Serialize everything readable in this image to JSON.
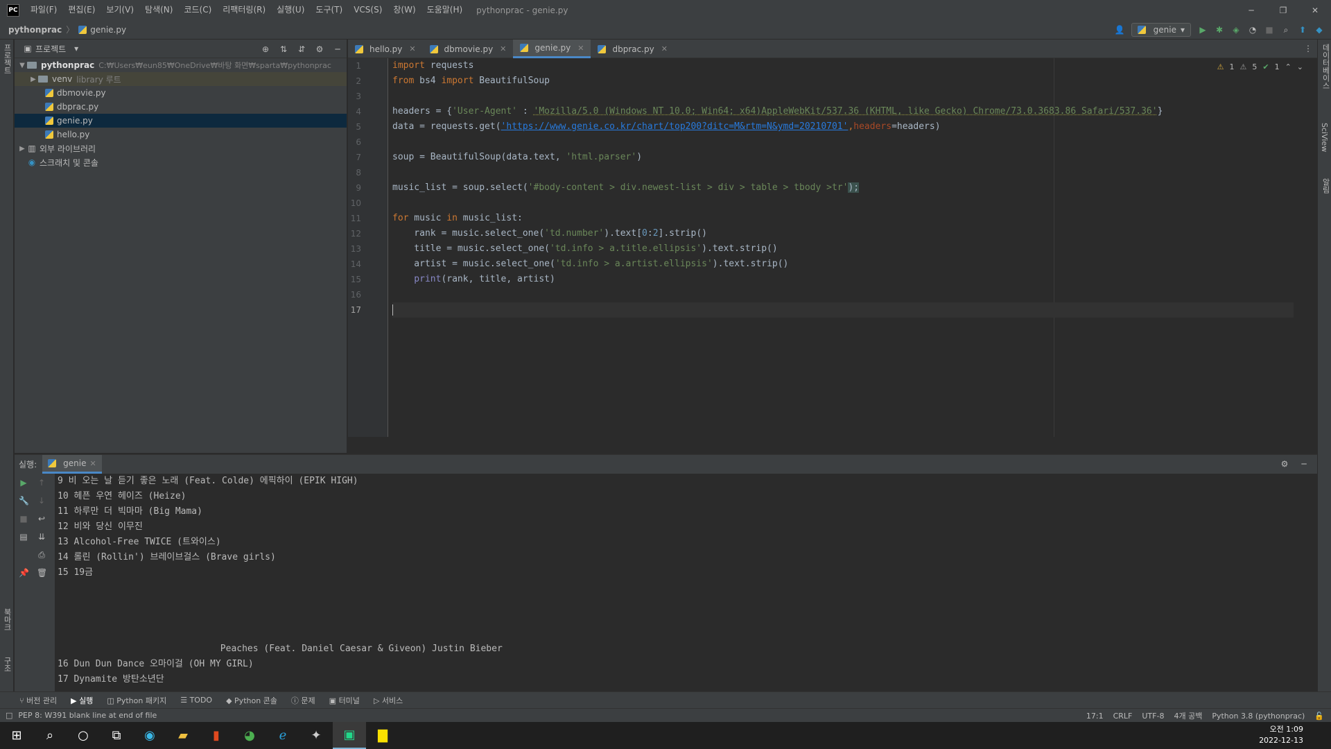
{
  "app": {
    "logo": "PC",
    "window_title": "pythonprac - genie.py"
  },
  "menu": [
    "파일(F)",
    "편집(E)",
    "보기(V)",
    "탐색(N)",
    "코드(C)",
    "리팩터링(R)",
    "실행(U)",
    "도구(T)",
    "VCS(S)",
    "창(W)",
    "도움말(H)"
  ],
  "breadcrumb": {
    "project": "pythonprac",
    "file": "genie.py"
  },
  "run_config": {
    "name": "genie"
  },
  "left_strip": {
    "project_tab": "프로젝트",
    "bookmarks_tab": "북마크",
    "structure_tab": "구조"
  },
  "right_strip": {
    "db_tab": "데이터베이스",
    "sciview_tab": "SciView",
    "notifications_tab": "알림"
  },
  "project_panel": {
    "title": "프로젝트",
    "root": {
      "name": "pythonprac",
      "path": "C:₩Users₩eun85₩OneDrive₩바탕 화면₩sparta₩pythonprac"
    },
    "venv": {
      "name": "venv",
      "note": "library 루트"
    },
    "files": [
      "dbmovie.py",
      "dbprac.py",
      "genie.py",
      "hello.py"
    ],
    "external": "외부 라이브러리",
    "scratches": "스크래치 및 콘솔"
  },
  "editor_tabs": [
    "hello.py",
    "dbmovie.py",
    "genie.py",
    "dbprac.py"
  ],
  "active_tab": "genie.py",
  "inspections": {
    "warnings": "1",
    "weak_warnings": "5",
    "ok": "1"
  },
  "line_numbers": [
    "1",
    "2",
    "3",
    "4",
    "5",
    "6",
    "7",
    "8",
    "9",
    "10",
    "11",
    "12",
    "13",
    "14",
    "15",
    "16",
    "17"
  ],
  "code": {
    "l1_kw": "import",
    "l1_rest": " requests",
    "l2_kw1": "from",
    "l2_mid": " bs4 ",
    "l2_kw2": "import",
    "l2_rest": " BeautifulSoup",
    "l4_a": "headers = {",
    "l4_key": "'User-Agent'",
    "l4_colon": " : ",
    "l4_val": "'Mozilla/5.0 (Windows NT 10.0; Win64; x64)AppleWebKit/537.36 (KHTML, like Gecko) Chrome/73.0.3683.86 Safari/537.36'",
    "l4_end": "}",
    "l5_a": "data = requests.get(",
    "l5_url": "'https://www.genie.co.kr/chart/top200?ditc=M&rtm=N&ymd=20210701'",
    "l5_comma": ",",
    "l5_param": "headers",
    "l5_end": "=headers)",
    "l7_a": "soup = BeautifulSoup(data.text, ",
    "l7_str": "'html.parser'",
    "l7_end": ")",
    "l9_a": "music_list = soup.select(",
    "l9_str": "'#body-content > div.newest-list > div > table > tbody >tr'",
    "l9_end": ");",
    "l11_kw": "for",
    "l11_mid": " music ",
    "l11_kw2": "in",
    "l11_end": " music_list:",
    "l12_a": "    rank = music.select_one(",
    "l12_str": "'td.number'",
    "l12_b": ").text[",
    "l12_n1": "0",
    "l12_c": ":",
    "l12_n2": "2",
    "l12_end": "].strip()",
    "l13_a": "    title = music.select_one(",
    "l13_str": "'td.info > a.title.ellipsis'",
    "l13_end": ").text.strip()",
    "l14_a": "    artist = music.select_one(",
    "l14_str": "'td.info > a.artist.ellipsis'",
    "l14_end": ").text.strip()",
    "l15_fn": "    print",
    "l15_end": "(rank, title, artist)"
  },
  "run_panel": {
    "label": "실행:",
    "tab": "genie"
  },
  "console_lines": [
    "9 비 오는 날 듣기 좋은 노래 (Feat. Colde) 에픽하이 (EPIK HIGH)",
    "10 헤픈 우연 헤이즈 (Heize)",
    "11 하루만 더 빅마마 (Big Mama)",
    "12 비와 당신 이무진",
    "13 Alcohol-Free TWICE (트와이스)",
    "14 롤린 (Rollin') 브레이브걸스 (Brave girls)",
    "15 19금",
    "",
    "",
    "",
    "",
    "                              Peaches (Feat. Daniel Caesar & Giveon) Justin Bieber",
    "16 Dun Dun Dance 오마이걸 (OH MY GIRL)",
    "17 Dynamite 방탄소년단"
  ],
  "bottom_tabs": [
    "버전 관리",
    "실행",
    "Python 패키지",
    "TODO",
    "Python 콘솔",
    "문제",
    "터미널",
    "서비스"
  ],
  "status": {
    "message": "PEP 8: W391 blank line at end of file",
    "position": "17:1",
    "line_sep": "CRLF",
    "encoding": "UTF-8",
    "indent": "4개 공백",
    "interpreter": "Python 3.8 (pythonprac)"
  },
  "clock": {
    "time": "오전 1:09",
    "date": "2022-12-13"
  }
}
